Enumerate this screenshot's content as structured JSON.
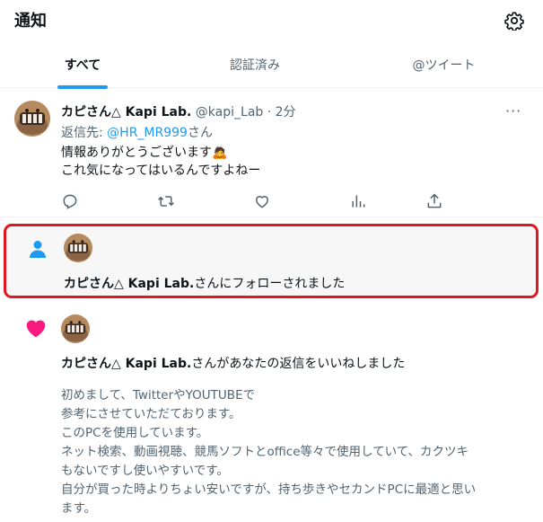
{
  "header": {
    "title": "通知",
    "settings_icon": "gear-icon"
  },
  "tabs": [
    {
      "label": "すべて",
      "active": true
    },
    {
      "label": "認証済み",
      "active": false
    },
    {
      "label": "@ツイート",
      "active": false
    }
  ],
  "tweet": {
    "author_name": "カピさん△ Kapi Lab.",
    "handle": "@kapi_Lab",
    "separator": "·",
    "time": "2分",
    "more": "···",
    "reply_prefix": "返信先: ",
    "reply_mention": "@HR_MR999",
    "reply_suffix": "さん",
    "text_line1": "情報ありがとうございます",
    "emoji": "🙇",
    "text_line2": "これ気になってはいるんですよねー",
    "action_icons": [
      "reply-icon",
      "retweet-icon",
      "like-icon",
      "analytics-icon",
      "share-icon"
    ]
  },
  "follow_notification": {
    "name": "カピさん△ Kapi Lab.",
    "suffix": "さんにフォローされました"
  },
  "like_notification": {
    "name": "カピさん△ Kapi Lab.",
    "suffix": "さんがあなたの返信をいいねしました",
    "quoted_lines": [
      "初めまして、TwitterやYOUTUBEで",
      "参考にさせていただております。",
      "このPCを使用しています。",
      "ネット検索、動画視聴、競馬ソフトとoffice等々で使用していて、カクツキ",
      "もないですし使いやすいです。",
      "自分が買った時よりちょい安いですが、持ち歩きやセカンドPCに最適と思い",
      "ます。"
    ]
  },
  "colors": {
    "accent": "#1d9bf0",
    "like": "#f91880",
    "highlight_border": "#e0171f",
    "muted": "#536471"
  }
}
